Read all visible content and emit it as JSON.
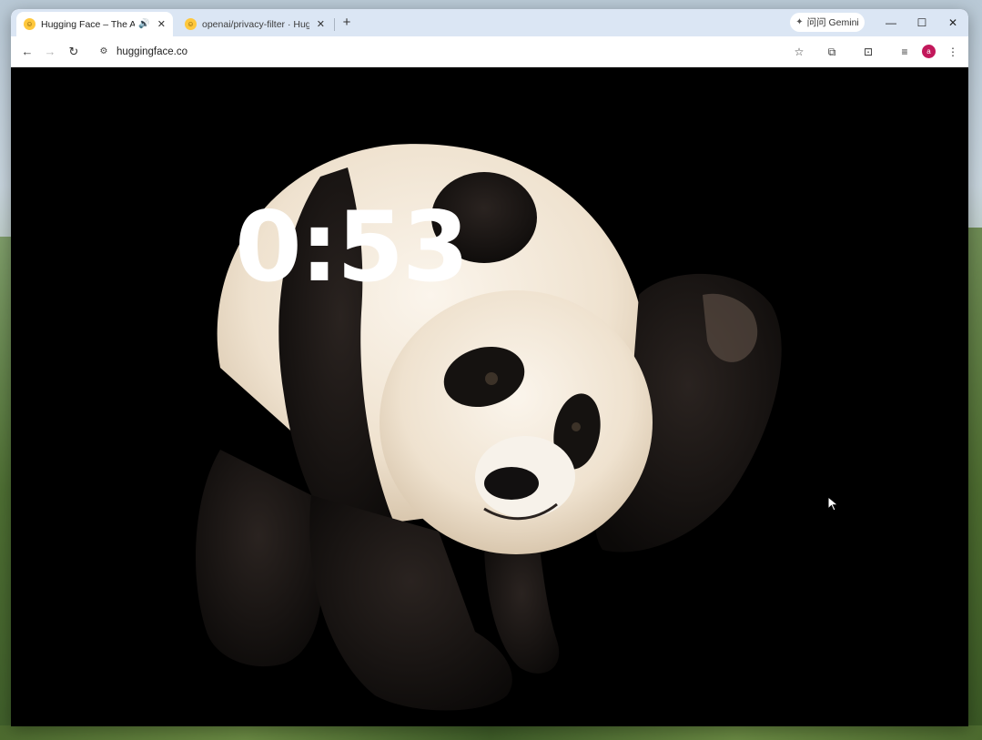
{
  "browser": {
    "tabs": [
      {
        "title": "Hugging Face – The AI co",
        "active": true,
        "audio": true
      },
      {
        "title": "openai/privacy-filter · Huggi",
        "active": false
      }
    ],
    "gemini_label": "问问 Gemini",
    "url": "huggingface.co",
    "profile_initial": "a"
  },
  "video": {
    "countdown": "0:53"
  },
  "colors": {
    "tabbar": "#dbe6f4",
    "active_tab": "#ffffff",
    "favicon": "#ffc83d",
    "avatar": "#c2185b",
    "video_bg": "#000000",
    "timer_text": "#ffffff"
  }
}
